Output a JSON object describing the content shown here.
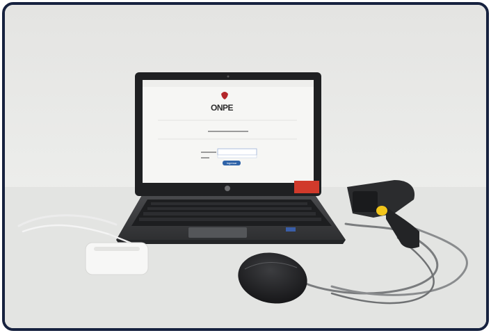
{
  "photo": {
    "screen_logo_text": "ONPE",
    "login_button_label": "Ingresar",
    "colors": {
      "frame_border": "#17223f",
      "background": "#e9e9e7",
      "laptop_body": "#3a3b3d",
      "login_button": "#2f63a8",
      "red_sticker": "#d13a2b",
      "scanner_trigger": "#f2c51a"
    },
    "objects": [
      "laptop",
      "barcode-scanner",
      "computer-mouse",
      "card-reader",
      "usb-cables"
    ]
  }
}
